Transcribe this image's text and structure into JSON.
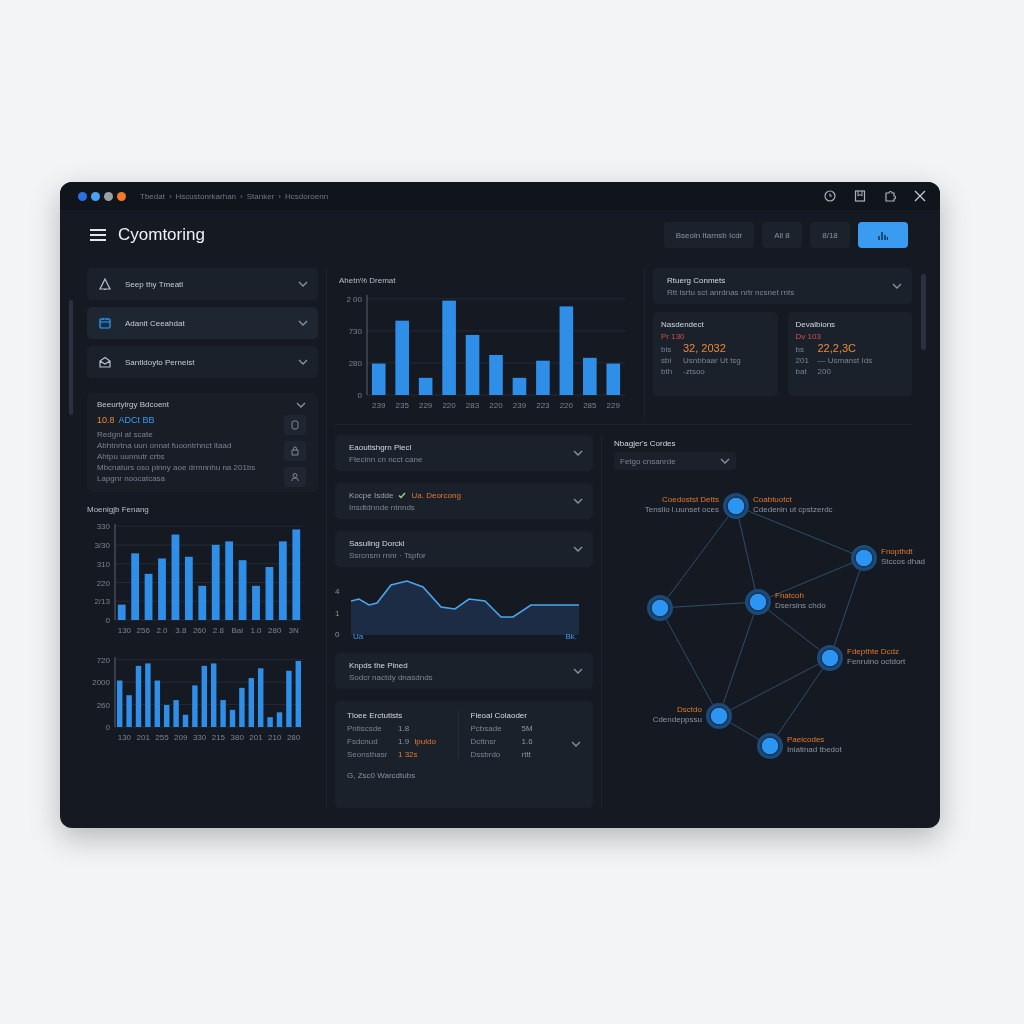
{
  "window": {
    "controls": [
      {
        "color": "#2f6fe0"
      },
      {
        "color": "#49a3f0"
      },
      {
        "color": "#9aa0a8"
      },
      {
        "color": "#f07a2a"
      }
    ],
    "breadcrumb": {
      "separator": "›",
      "items": [
        "Tbedat",
        "Hscustonrkarhan",
        "Stanker",
        "Hcsdoroenn"
      ]
    },
    "title": "Cyomtoring"
  },
  "header_buttons": [
    {
      "kind": "plain",
      "label": "Bseoln Itarnsb Icdr"
    },
    {
      "kind": "plain",
      "label": "All 8"
    },
    {
      "kind": "plain",
      "label": "8/18"
    },
    {
      "kind": "primary"
    }
  ],
  "sidebar": {
    "items": [
      {
        "kind": "bell",
        "label": "Seep thy Tmeatl",
        "selected": false,
        "expanded": false
      },
      {
        "kind": "calendar",
        "label": "Adanit Ceeahdat",
        "selected": true,
        "expanded": false
      },
      {
        "kind": "mail",
        "label": "Santldoyto Perneist",
        "selected": false,
        "expanded": false
      }
    ]
  },
  "summary_card": {
    "title": "Beeurtylrgy Bdcoent",
    "value": "10.8",
    "unit": "ADCt BB",
    "lines": [
      "Redgnl at scate",
      "Abhtnrtna uun onnat fuoontrhnct ltaad",
      "Ahtpu uunnutr crbs",
      "Mbcnaturs oso pinny aoe drmnnhu na 201bs",
      "Lapgnr noocatcasa"
    ]
  },
  "chart_left": {
    "title": "Moenigjb Fenang",
    "y_labels": [
      "330",
      "3/30",
      "310",
      "220",
      "2/13",
      "0"
    ],
    "x_labels": [
      "130",
      "256",
      "2.0",
      "3.8",
      "260",
      "2.8",
      "Bai",
      "1.0",
      "280",
      "3N"
    ]
  },
  "chart_left_2": {
    "y_labels": [
      "720",
      "2000",
      "260",
      "0"
    ],
    "x_labels": [
      "130",
      "201",
      "255",
      "209",
      "330",
      "215",
      "380",
      "201",
      "210",
      "280"
    ]
  },
  "top_chart": {
    "title": "Ahetn% Dremat",
    "y_labels": [
      "2 00",
      "730",
      "280",
      "0"
    ],
    "x_labels": [
      "239",
      "235",
      "229",
      "220",
      "283",
      "220",
      "239",
      "223",
      "220",
      "285",
      "229"
    ]
  },
  "alerts_panel": {
    "title": "Rtuerg Conmets",
    "subtitle": "Rtt tsrtu sct anrdnas nrtr ncsnet rnts",
    "expanded": false
  },
  "stat_cards": [
    {
      "title": "Nasdendect",
      "tag": "Pr 130",
      "prefix": "bis",
      "value": "32, 2032",
      "rows": [
        {
          "key": "sbi",
          "value": "Usnbbaar Ut tsg"
        },
        {
          "key": "bth",
          "value": "-ztsoo"
        }
      ]
    },
    {
      "title": "Devalbions",
      "tag": "Dv 103",
      "prefix": "bs",
      "value": "22,2,3C",
      "rows": [
        {
          "key": "201",
          "value": "— Usmanst Ids"
        },
        {
          "key": "bat",
          "value": "200"
        }
      ]
    }
  ],
  "panels": [
    {
      "title": "Eaoutishgrn Piecl",
      "subtitle": "Ftecinn cn ncct cane",
      "expanded": false
    },
    {
      "title": "Kocpe   Isdde",
      "status": "Ua. Deorcong",
      "checked": true,
      "subtitle": "Insdtdnnde ntnnds",
      "expanded": false
    },
    {
      "title": "Sasuling Dorcki",
      "subtitle": "Ssrcnsrn rnnr · Tspfor",
      "expanded": false
    }
  ],
  "trend": {
    "axis_labels": [
      "4",
      "1",
      "0"
    ],
    "start_label": "Ua",
    "end_label": "Bk."
  },
  "panels_2": [
    {
      "title": "Knpds the Pined",
      "subtitle": "Sodcr nactdy dnasdnds",
      "expanded": false
    }
  ],
  "stats_card": {
    "columns": [
      {
        "title": "Tloee Erctutists",
        "rows": [
          {
            "key": "Pntiscsde",
            "value": "1.8",
            "highlight": false
          },
          {
            "key": "Fsdcnud",
            "value": "1.9",
            "note": "Ipuldo",
            "highlight": false
          },
          {
            "key": "Seonsthasr",
            "value": "1 32s",
            "highlight": true
          }
        ]
      },
      {
        "title": "Fleoal Colaoder",
        "rows": [
          {
            "key": "Pcbsade",
            "value": "5M",
            "highlight": false
          },
          {
            "key": "Dcttnsr",
            "value": "1.6",
            "highlight": false
          },
          {
            "key": "Dssbrdo",
            "value": "rttt",
            "highlight": false
          }
        ]
      }
    ],
    "footer": "G, Zsc0 Warcdtubs"
  },
  "network": {
    "title": "Nbagjer's Cordes",
    "filter": {
      "value": "Fetgo cnsanrde"
    },
    "nodes": [
      {
        "kind": "labeled",
        "labels": [
          {
            "kind": "left",
            "title": "Coedostst Detts",
            "subtitle": "Tenslio l.uunset oces"
          },
          {
            "kind": "right",
            "title": "Coabtuotct",
            "subtitle": "Cdedenin ut cpstzerdc"
          }
        ]
      },
      {
        "kind": "labeled",
        "labels": [
          {
            "kind": "right",
            "title": "Fnopthdt",
            "subtitle": "Stccos dhad"
          }
        ]
      },
      {
        "kind": "unlabeled"
      },
      {
        "kind": "labeled",
        "labels": [
          {
            "kind": "right",
            "title": "Fnatcoh",
            "subtitle": "Dsersins chdo"
          }
        ]
      },
      {
        "kind": "labeled",
        "labels": [
          {
            "kind": "right",
            "title": "Fdepthte Dcdz",
            "subtitle": "Fenruino octdort"
          }
        ]
      },
      {
        "kind": "labeled",
        "labels": [
          {
            "kind": "left",
            "title": "Dsctdo",
            "subtitle": "Cdendeppssu"
          }
        ]
      },
      {
        "kind": "labeled",
        "labels": [
          {
            "kind": "right",
            "title": "Paeicodes",
            "subtitle": "Iniatinad tbedot"
          }
        ]
      }
    ]
  }
}
